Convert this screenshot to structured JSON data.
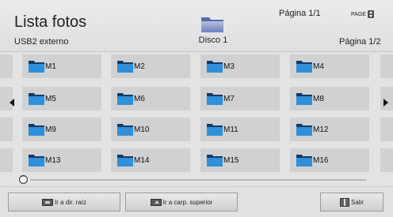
{
  "header": {
    "title": "Lista fotos",
    "source": "USB2 externo",
    "disc_label": "Disco 1",
    "page_top": "Página 1/1",
    "page_key_label": "PAGE",
    "page_right": "Página 1/2",
    "disc_icon": "folder-icon"
  },
  "grid": {
    "folders": [
      "M1",
      "M2",
      "M3",
      "M4",
      "M5",
      "M6",
      "M7",
      "M8",
      "M9",
      "M10",
      "M11",
      "M12",
      "M13",
      "M14",
      "M15",
      "M16"
    ],
    "item_icon": "folder-icon"
  },
  "navigation": {
    "left_arrow": "arrow-left-icon",
    "right_arrow": "arrow-right-icon"
  },
  "slider": {
    "position": 0
  },
  "bottom_bar": {
    "root_label": "Ir a dir. raíz",
    "parent_label": "Ir a carp. superior",
    "exit_label": "Salir"
  },
  "colors": {
    "folder_blue": "#2f8fd8",
    "folder_dark": "#143a66",
    "tile_bg": "#d0d1d3",
    "background": "#e3e3e4"
  }
}
